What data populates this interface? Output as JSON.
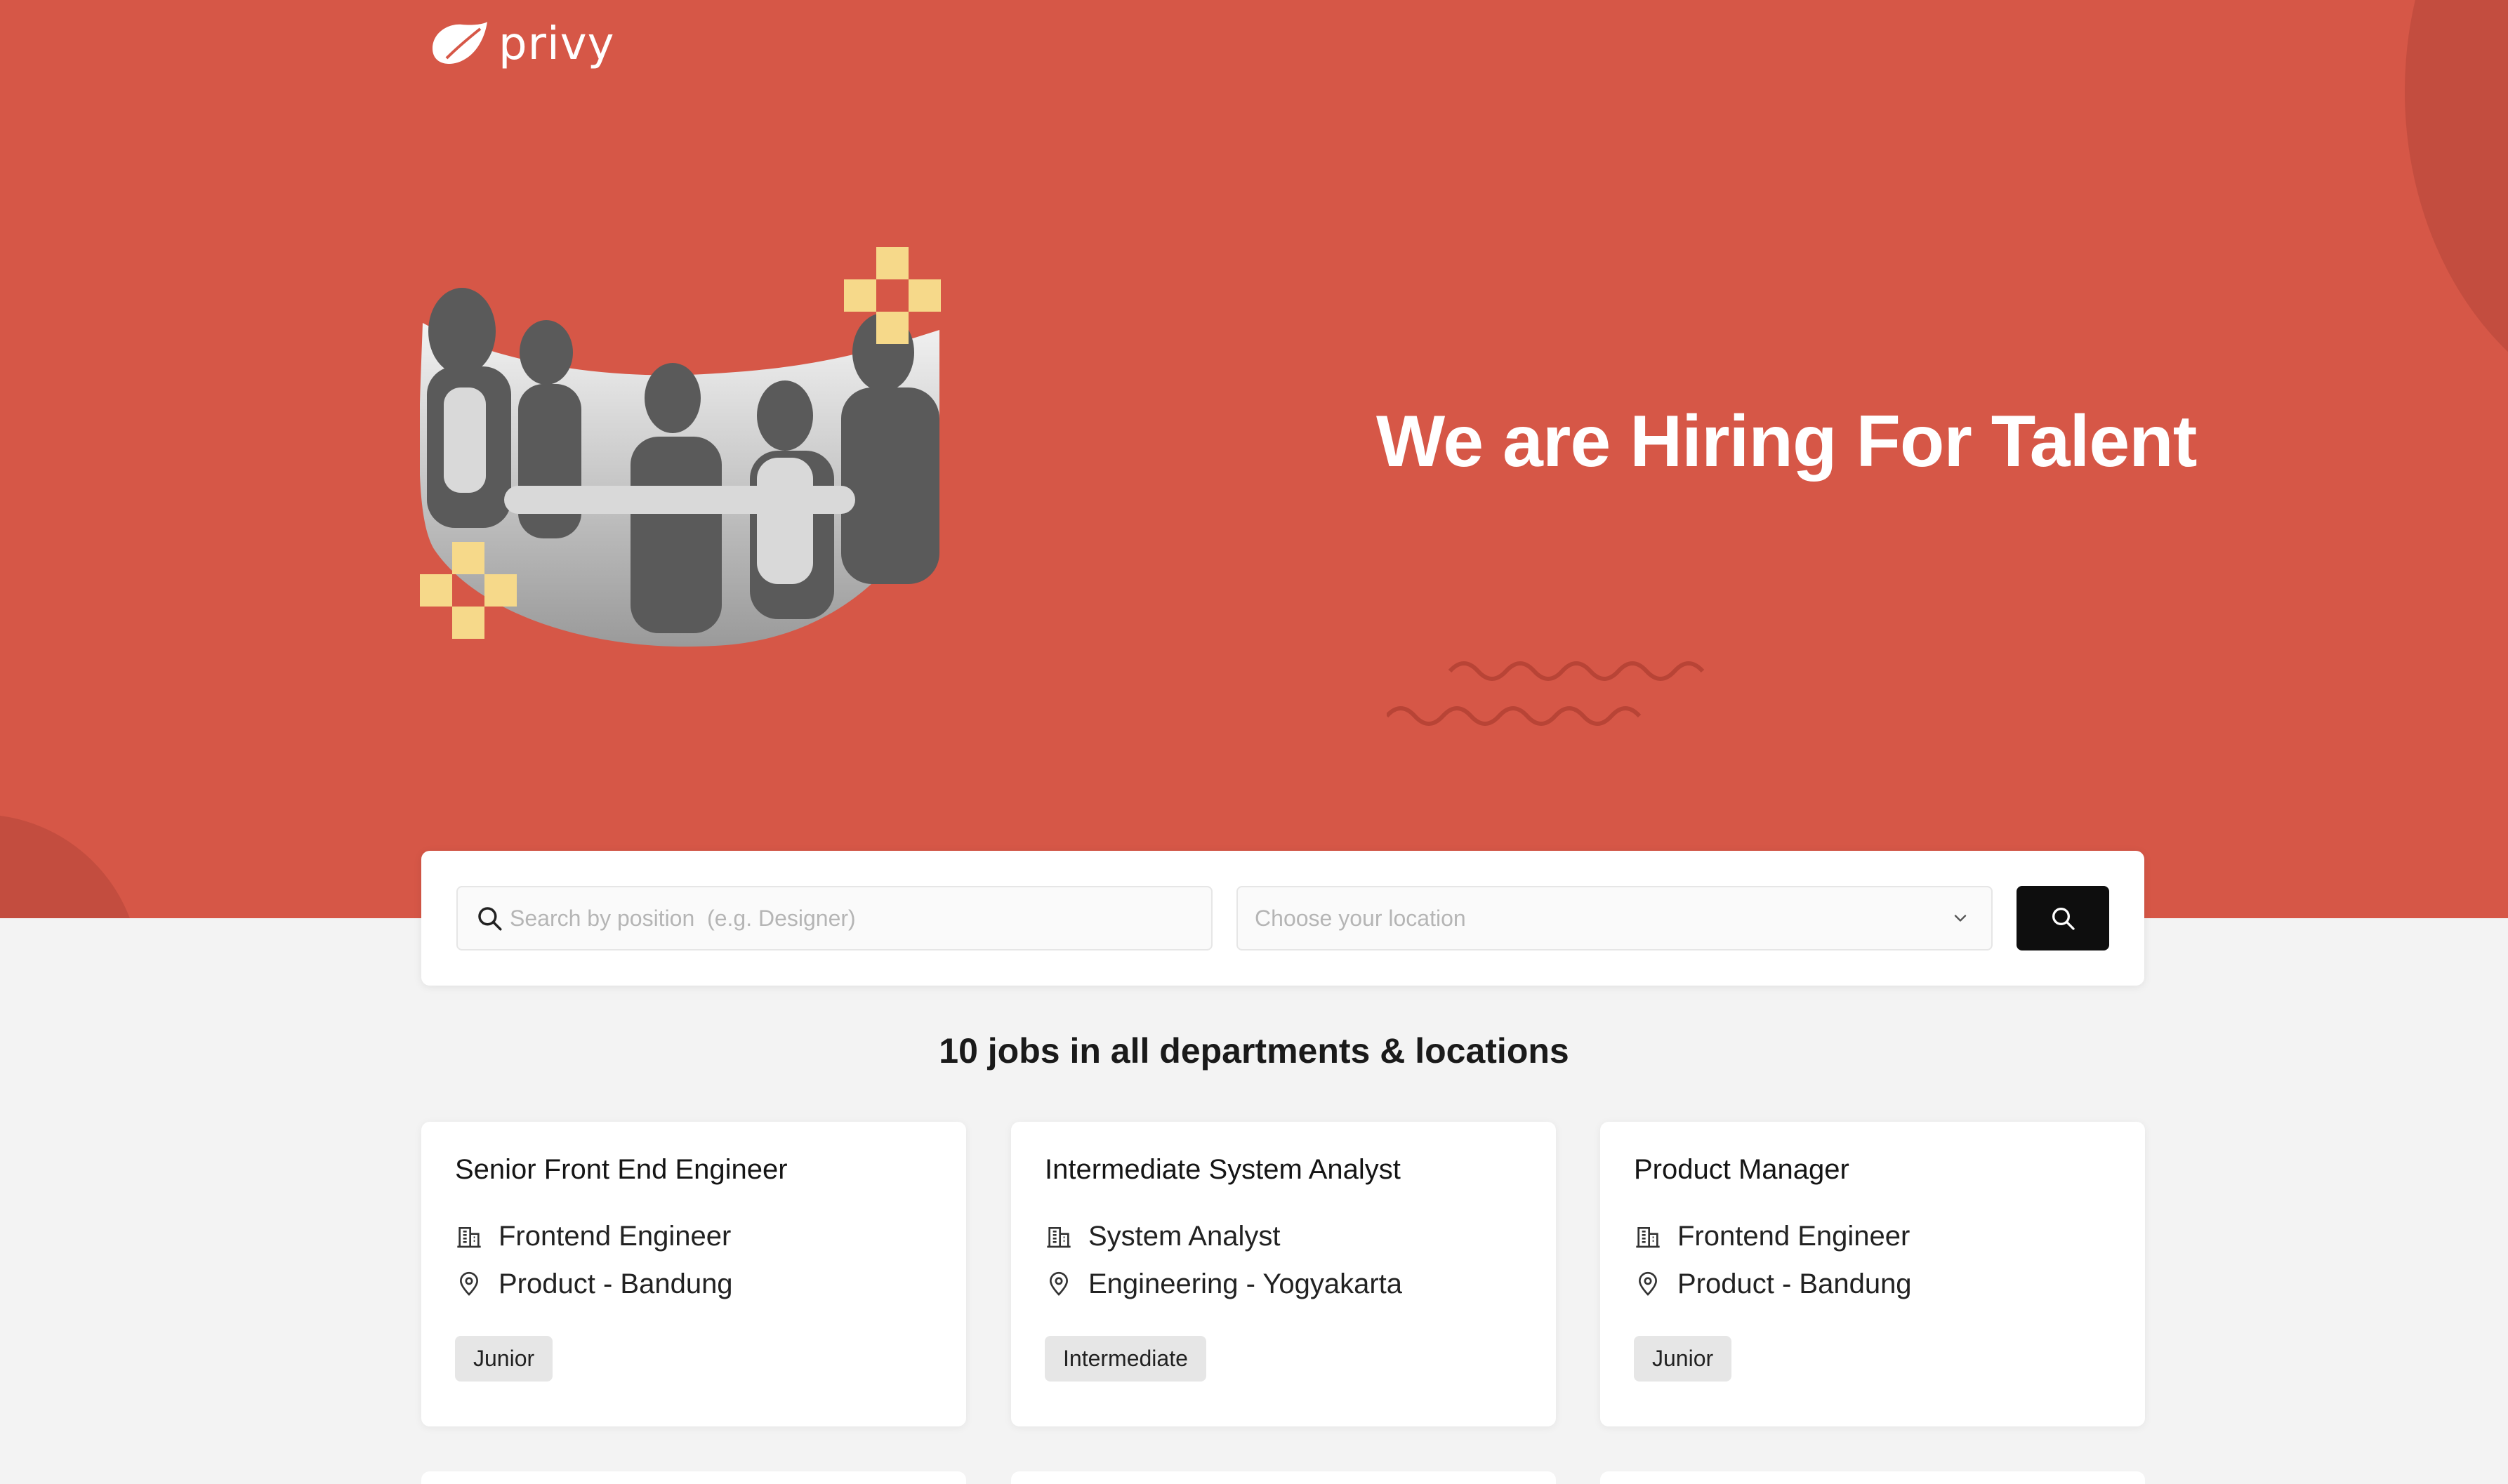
{
  "brand": {
    "logo_text": "privy",
    "primary_color": "#d65747",
    "accent_yellow": "#f6d98a"
  },
  "hero": {
    "title": "We are Hiring For Talent"
  },
  "search": {
    "position_placeholder": "Search by position  (e.g. Designer)",
    "location_placeholder": "Choose your location"
  },
  "jobs_heading": "10 jobs in all departments & locations",
  "jobs": [
    {
      "title": "Senior Front End Engineer",
      "role": "Frontend Engineer",
      "location": "Product - Bandung",
      "level": "Junior"
    },
    {
      "title": "Intermediate System Analyst",
      "role": "System Analyst",
      "location": "Engineering - Yogyakarta",
      "level": "Intermediate"
    },
    {
      "title": "Product Manager",
      "role": "Frontend Engineer",
      "location": "Product - Bandung",
      "level": "Junior"
    }
  ]
}
